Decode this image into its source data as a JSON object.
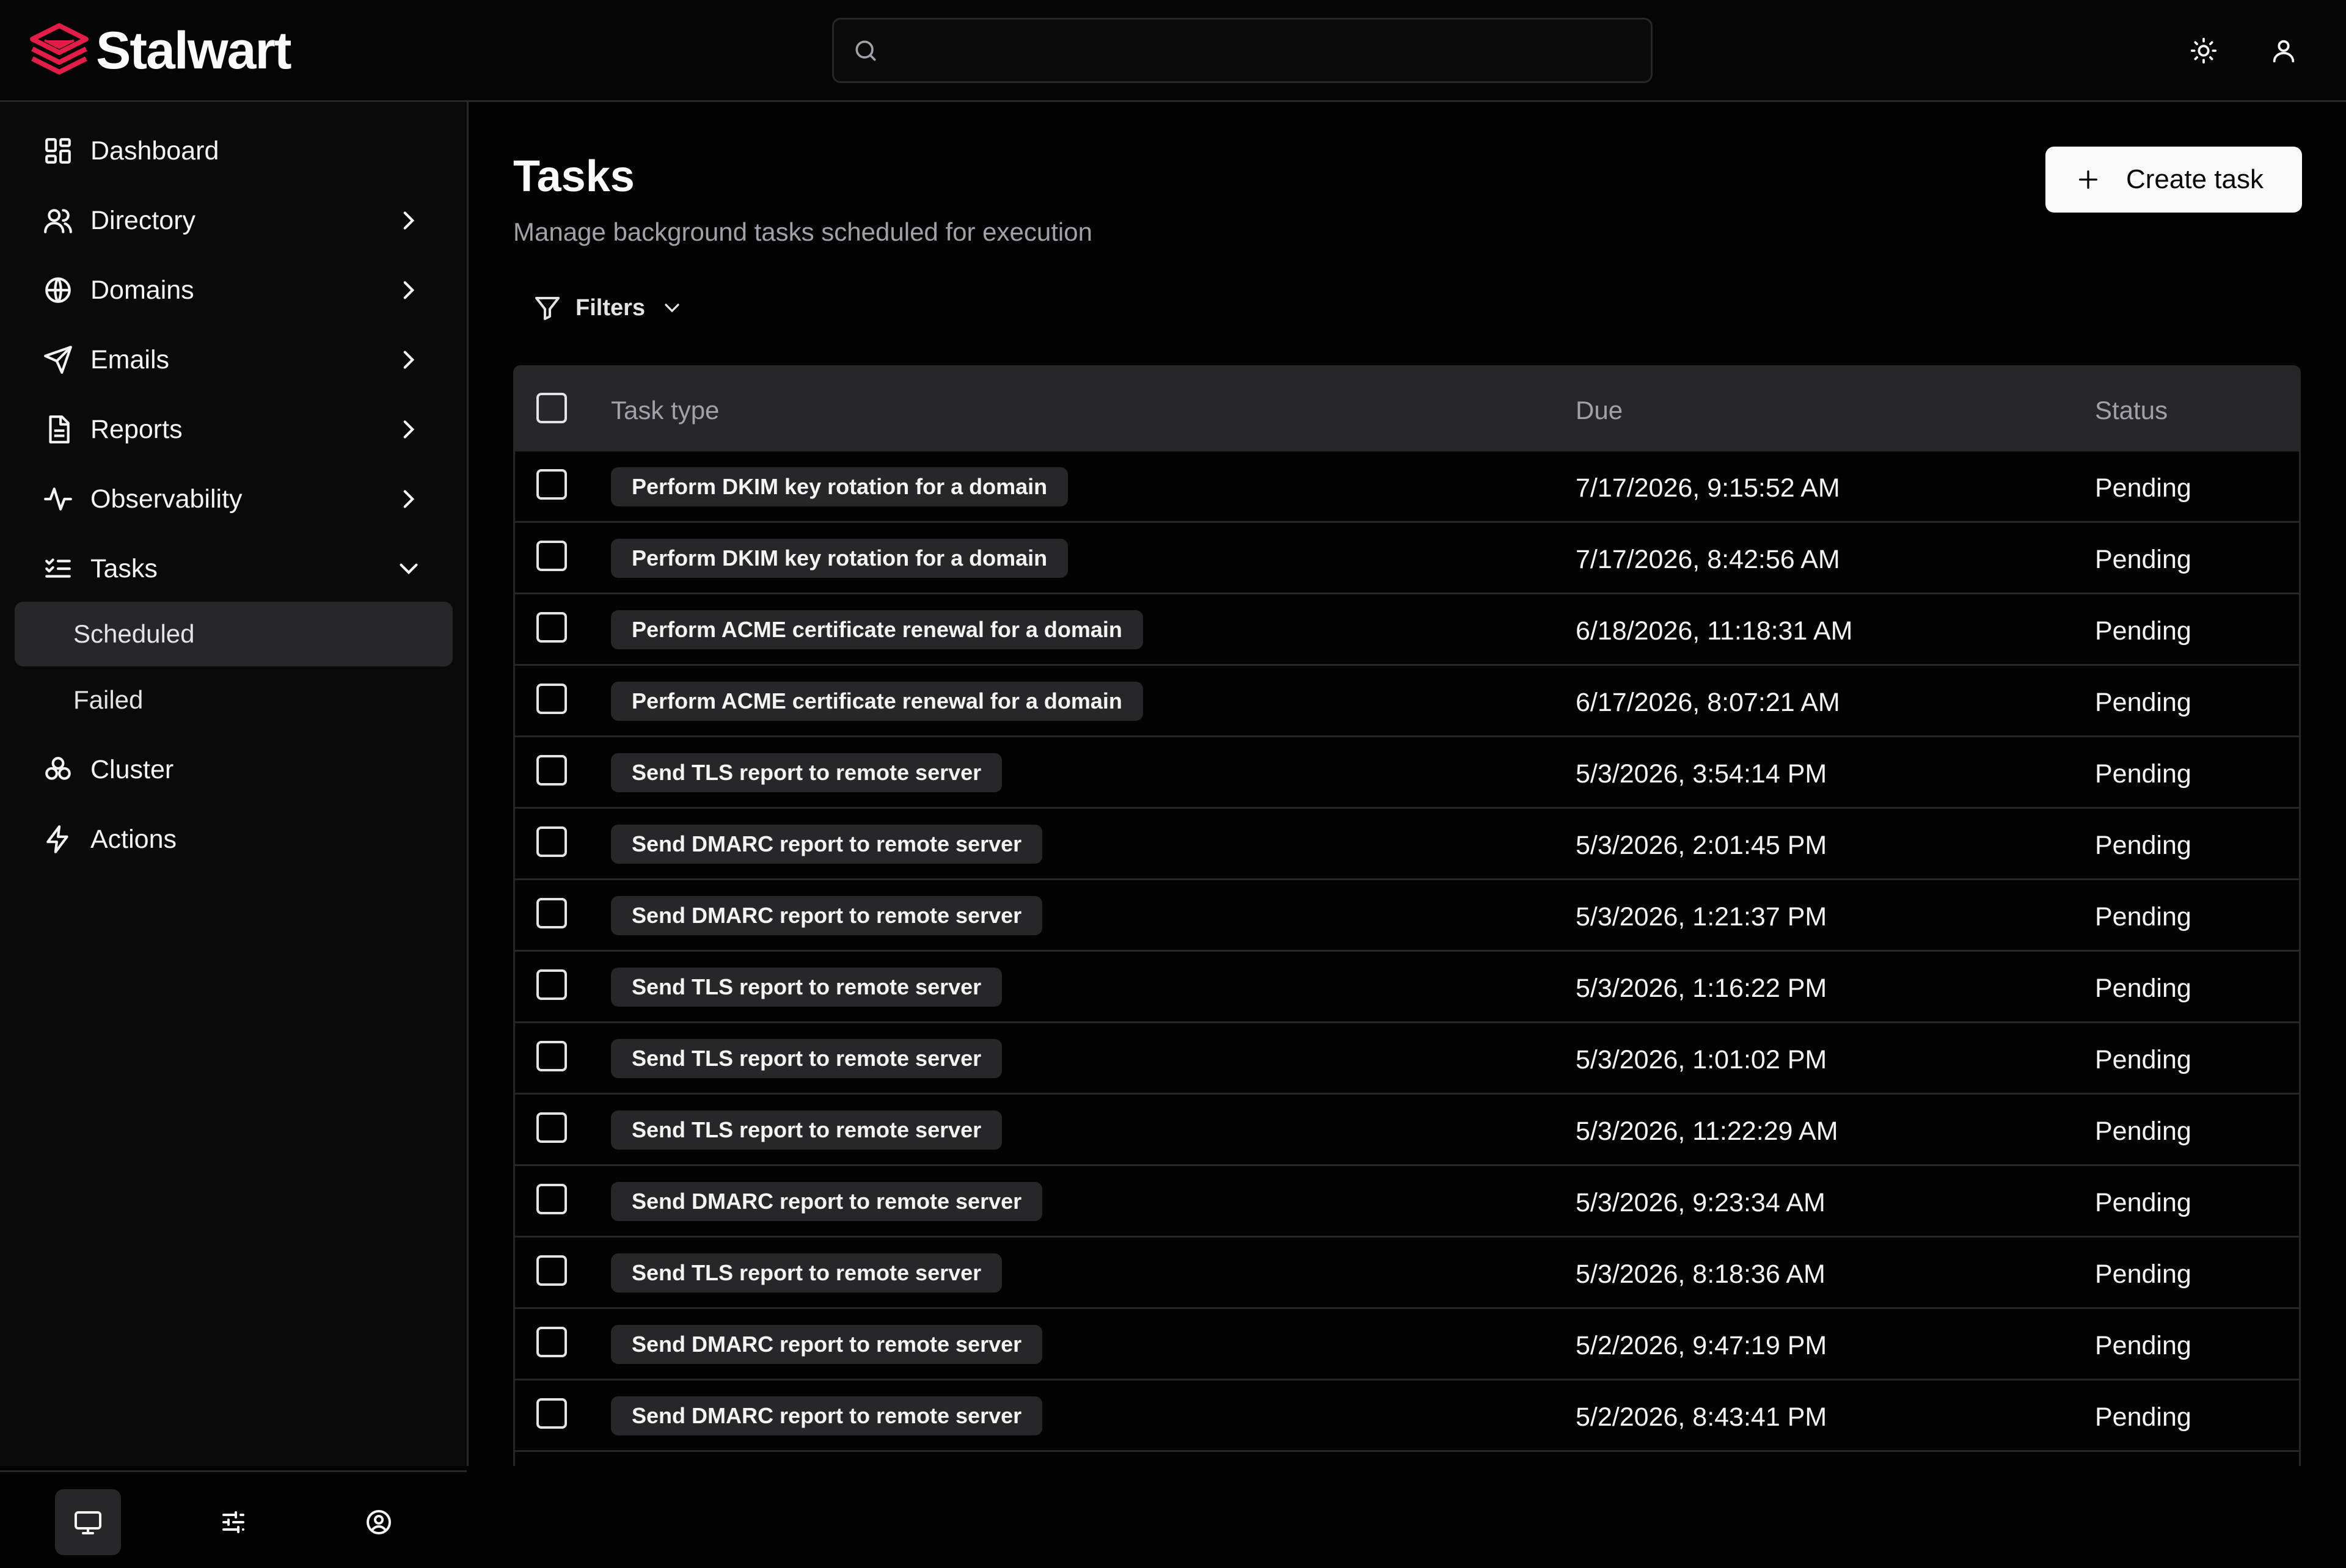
{
  "app": {
    "name": "Stalwart",
    "brand_color": "#e11d48"
  },
  "search": {
    "placeholder": ""
  },
  "sidebar": {
    "items": [
      {
        "label": "Dashboard",
        "icon": "dashboard-icon",
        "expandable": false
      },
      {
        "label": "Directory",
        "icon": "users-icon",
        "expandable": true
      },
      {
        "label": "Domains",
        "icon": "globe-icon",
        "expandable": true
      },
      {
        "label": "Emails",
        "icon": "send-icon",
        "expandable": true
      },
      {
        "label": "Reports",
        "icon": "document-icon",
        "expandable": true
      },
      {
        "label": "Observability",
        "icon": "activity-icon",
        "expandable": true
      },
      {
        "label": "Tasks",
        "icon": "list-checks-icon",
        "expandable": true,
        "expanded": true
      },
      {
        "label": "Cluster",
        "icon": "cluster-icon",
        "expandable": false
      },
      {
        "label": "Actions",
        "icon": "zap-icon",
        "expandable": false
      }
    ],
    "tasks_sub": [
      {
        "label": "Scheduled",
        "active": true
      },
      {
        "label": "Failed",
        "active": false
      }
    ],
    "footer": [
      {
        "icon": "monitor-icon",
        "active": true
      },
      {
        "icon": "sliders-icon",
        "active": false
      },
      {
        "icon": "user-circle-icon",
        "active": false
      }
    ]
  },
  "main": {
    "title": "Tasks",
    "subtitle": "Manage background tasks scheduled for execution",
    "create_label": "Create task",
    "filters_label": "Filters"
  },
  "table": {
    "columns": [
      "Task type",
      "Due",
      "Status"
    ],
    "rows": [
      {
        "type": "Perform DKIM key rotation for a domain",
        "due": "7/17/2026, 9:15:52 AM",
        "status": "Pending"
      },
      {
        "type": "Perform DKIM key rotation for a domain",
        "due": "7/17/2026, 8:42:56 AM",
        "status": "Pending"
      },
      {
        "type": "Perform ACME certificate renewal for a domain",
        "due": "6/18/2026, 11:18:31 AM",
        "status": "Pending"
      },
      {
        "type": "Perform ACME certificate renewal for a domain",
        "due": "6/17/2026, 8:07:21 AM",
        "status": "Pending"
      },
      {
        "type": "Send TLS report to remote server",
        "due": "5/3/2026, 3:54:14 PM",
        "status": "Pending"
      },
      {
        "type": "Send DMARC report to remote server",
        "due": "5/3/2026, 2:01:45 PM",
        "status": "Pending"
      },
      {
        "type": "Send DMARC report to remote server",
        "due": "5/3/2026, 1:21:37 PM",
        "status": "Pending"
      },
      {
        "type": "Send TLS report to remote server",
        "due": "5/3/2026, 1:16:22 PM",
        "status": "Pending"
      },
      {
        "type": "Send TLS report to remote server",
        "due": "5/3/2026, 1:01:02 PM",
        "status": "Pending"
      },
      {
        "type": "Send TLS report to remote server",
        "due": "5/3/2026, 11:22:29 AM",
        "status": "Pending"
      },
      {
        "type": "Send DMARC report to remote server",
        "due": "5/3/2026, 9:23:34 AM",
        "status": "Pending"
      },
      {
        "type": "Send TLS report to remote server",
        "due": "5/3/2026, 8:18:36 AM",
        "status": "Pending"
      },
      {
        "type": "Send DMARC report to remote server",
        "due": "5/2/2026, 9:47:19 PM",
        "status": "Pending"
      },
      {
        "type": "Send DMARC report to remote server",
        "due": "5/2/2026, 8:43:41 PM",
        "status": "Pending"
      }
    ]
  }
}
